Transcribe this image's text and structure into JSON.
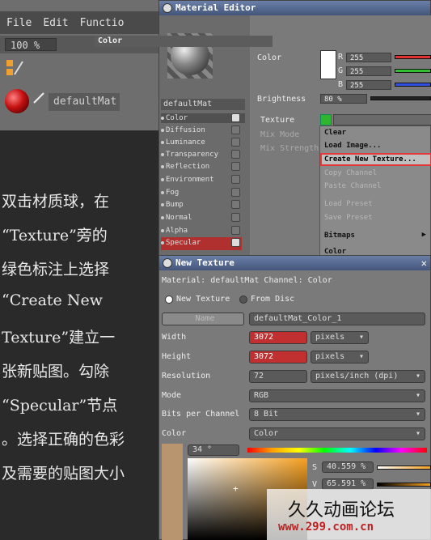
{
  "menubar": {
    "file": "File",
    "edit": "Edit",
    "function": "Functio"
  },
  "zoom": "100 %",
  "material_label": "defaultMat",
  "tutorial_lines": [
    "双击材质球，在",
    "“Texture”旁的",
    "绿色标注上选择",
    "“Create New",
    "Texture”建立一",
    "张新贴图。勾除",
    "“Specular”节点",
    "。选择正确的色彩",
    "及需要的贴图大小"
  ],
  "material_editor": {
    "title": "Material Editor",
    "mat_name": "defaultMat",
    "channels": [
      {
        "label": "Color",
        "checked": true
      },
      {
        "label": "Diffusion",
        "checked": false
      },
      {
        "label": "Luminance",
        "checked": false
      },
      {
        "label": "Transparency",
        "checked": false
      },
      {
        "label": "Reflection",
        "checked": false
      },
      {
        "label": "Environment",
        "checked": false
      },
      {
        "label": "Fog",
        "checked": false
      },
      {
        "label": "Bump",
        "checked": false
      },
      {
        "label": "Normal",
        "checked": false
      },
      {
        "label": "Alpha",
        "checked": false
      },
      {
        "label": "Specular",
        "checked": true
      }
    ],
    "section": "Color",
    "color_label": "Color",
    "r_label": "R",
    "r_value": "255",
    "g_label": "G",
    "g_value": "255",
    "b_label": "B",
    "b_value": "255",
    "brightness_label": "Brightness",
    "brightness_value": "80 %",
    "texture_label": "Texture",
    "mix_mode_label": "Mix Mode",
    "mix_strength_label": "Mix Strength"
  },
  "context_menu": [
    {
      "label": "Clear",
      "state": "normal"
    },
    {
      "label": "Load Image...",
      "state": "normal"
    },
    {
      "label": "Create New Texture...",
      "state": "highlight"
    },
    {
      "label": "Copy Channel",
      "state": "disabled"
    },
    {
      "label": "Paste Channel",
      "state": "disabled"
    },
    {
      "label": "Load Preset",
      "state": "disabled"
    },
    {
      "label": "Save Preset",
      "state": "disabled"
    },
    {
      "label": "Bitmaps",
      "state": "normal"
    },
    {
      "label": "Color",
      "state": "normal"
    }
  ],
  "new_texture": {
    "title": "New Texture",
    "info": "Material: defaultMat Channel: Color",
    "opt_new": "New Texture",
    "opt_disc": "From Disc",
    "name_btn": "Name",
    "name_value": "defaultMat_Color_1",
    "width_label": "Width",
    "width_value": "3072",
    "width_unit": "pixels",
    "height_label": "Height",
    "height_value": "3072",
    "height_unit": "pixels",
    "res_label": "Resolution",
    "res_value": "72",
    "res_unit": "pixels/inch (dpi)",
    "mode_label": "Mode",
    "mode_value": "RGB",
    "bpc_label": "Bits per Channel",
    "bpc_value": "8 Bit",
    "color_label": "Color",
    "color_value": "Color",
    "hue_value": "34 °",
    "s_label": "S",
    "s_value": "40.559 %",
    "v_label": "V",
    "v_value": "65.591 %"
  },
  "watermark": {
    "line1": "久久动画论坛",
    "line2": "www.299.com.cn"
  },
  "colors": {
    "highlight": "#c03030",
    "green": "#2fb52f",
    "title": "#44557a"
  }
}
